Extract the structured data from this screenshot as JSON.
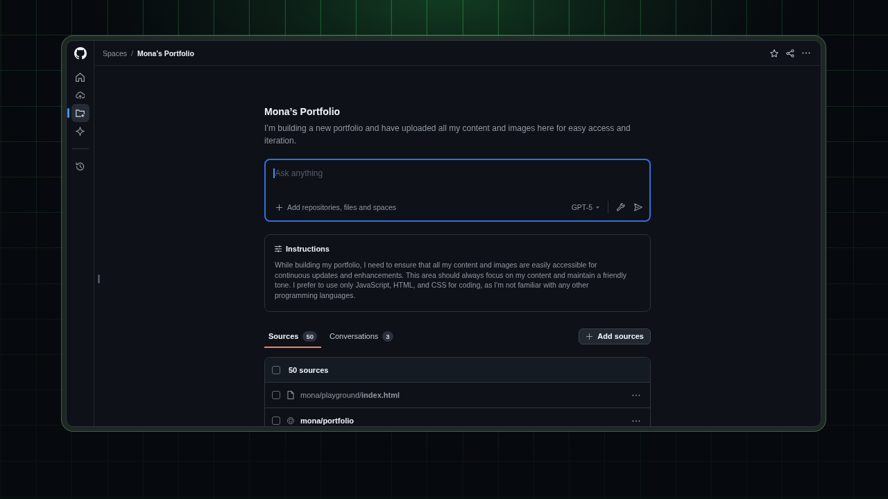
{
  "sidebar": {
    "nav_items": [
      {
        "selected": false
      },
      {
        "selected": false
      },
      {
        "selected": true
      },
      {
        "selected": false
      }
    ],
    "footer_items": [
      {
        "selected": false
      }
    ]
  },
  "breadcrumb": [
    {
      "label": "Spaces",
      "current": false
    },
    {
      "label": "Mona’s Portfolio",
      "current": true
    }
  ],
  "breadcrumb_separator": "/",
  "space": {
    "title": "Mona’s Portfolio",
    "description": "I’m building a new portfolio and have uploaded all my content and images here for easy access and iteration."
  },
  "prompt": {
    "placeholder": "Ask anything",
    "focused": true,
    "add_context_label": "Add repositories, files and spaces",
    "model": "GPT-5"
  },
  "instructions": {
    "title": "Instructions",
    "text": "While building my portfolio, I need to ensure that all my content and images are easily accessible for continuous updates and enhancements. This area should always focus on my content and maintain a friendly tone. I prefer to use only JavaScript, HTML, and CSS for coding, as I'm not familiar with any other programming languages."
  },
  "tabs": [
    {
      "label": "Sources",
      "count": "50",
      "selected": true
    },
    {
      "label": "Conversations",
      "count": "3",
      "selected": false
    }
  ],
  "add_sources_label": "Add sources",
  "sources": {
    "header": {
      "label": "50 sources",
      "checked": false
    },
    "items": [
      {
        "kind": "file",
        "path": "mona/playground/**index.html**",
        "checked": false
      },
      {
        "kind": "repo",
        "path": "mona/portfolio",
        "checked": false
      }
    ]
  }
}
